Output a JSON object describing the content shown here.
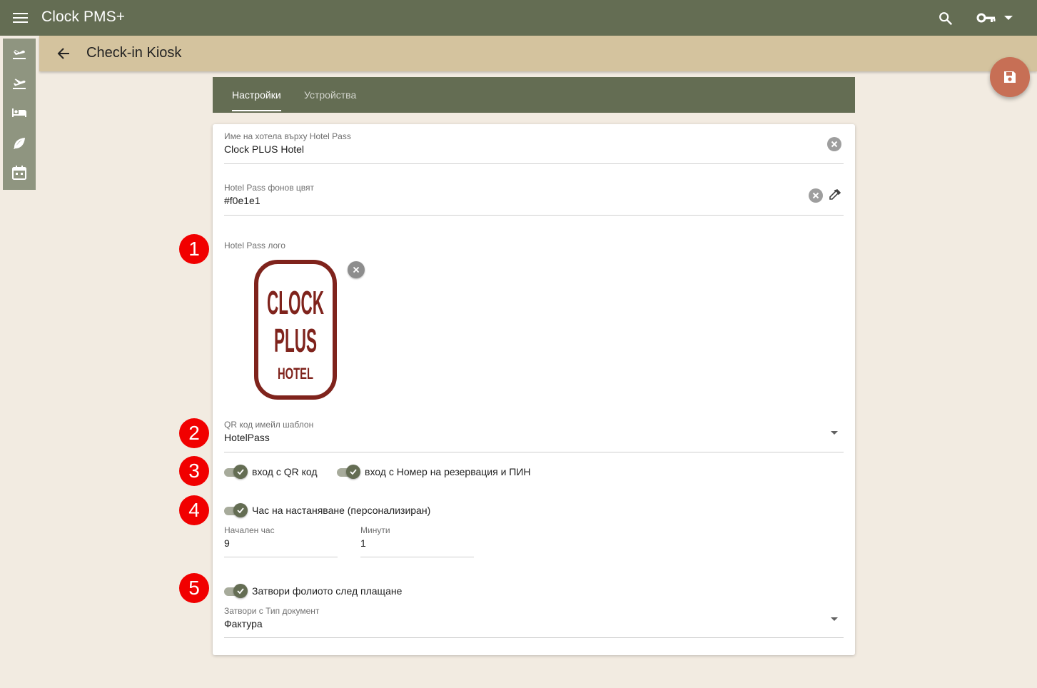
{
  "app": {
    "title": "Clock PMS+"
  },
  "header": {
    "title": "Check-in Kiosk"
  },
  "tabs": [
    {
      "label": "Настройки",
      "active": true
    },
    {
      "label": "Устройства",
      "active": false
    }
  ],
  "fields": {
    "hotel_name": {
      "label": "Име на хотела върху Hotel Pass",
      "value": "Clock PLUS Hotel"
    },
    "bg_color": {
      "label": "Hotel Pass фонов цвят",
      "value": "#f0e1e1"
    },
    "logo": {
      "label": "Hotel Pass лого",
      "logo_text": [
        "CLOCK",
        "PLUS",
        "HOTEL"
      ]
    },
    "qr_template": {
      "label": "QR код имейл шаблон",
      "value": "HotelPass"
    },
    "start_hour": {
      "label": "Начален час",
      "value": "9"
    },
    "minutes": {
      "label": "Минути",
      "value": "1"
    },
    "doc_type": {
      "label": "Затвори с Тип документ",
      "value": "Фактура"
    }
  },
  "toggles": {
    "qr_login": {
      "label": "вход с QR код",
      "checked": true
    },
    "pin_login": {
      "label": "вход с Номер на резервация и ПИН",
      "checked": true
    },
    "custom_checkin": {
      "label": "Час на настаняване (персонализиран)",
      "checked": true
    },
    "close_folio": {
      "label": "Затвори фолиото след плащане",
      "checked": true
    }
  },
  "markers": [
    "1",
    "2",
    "3",
    "4",
    "5"
  ],
  "colors": {
    "primary": "#646d53",
    "header": "#d4c39e",
    "fab": "#c76f55",
    "background": "#f2ebe1",
    "marker": "#f10000",
    "logo": "#7f231c"
  },
  "icons": [
    "menu-icon",
    "search-icon",
    "key-icon",
    "arrow-back-icon",
    "arrival-icon",
    "departure-icon",
    "bed-icon",
    "leaf-icon",
    "calendar-icon",
    "save-icon",
    "clear-icon",
    "eyedropper-icon",
    "check-icon"
  ]
}
